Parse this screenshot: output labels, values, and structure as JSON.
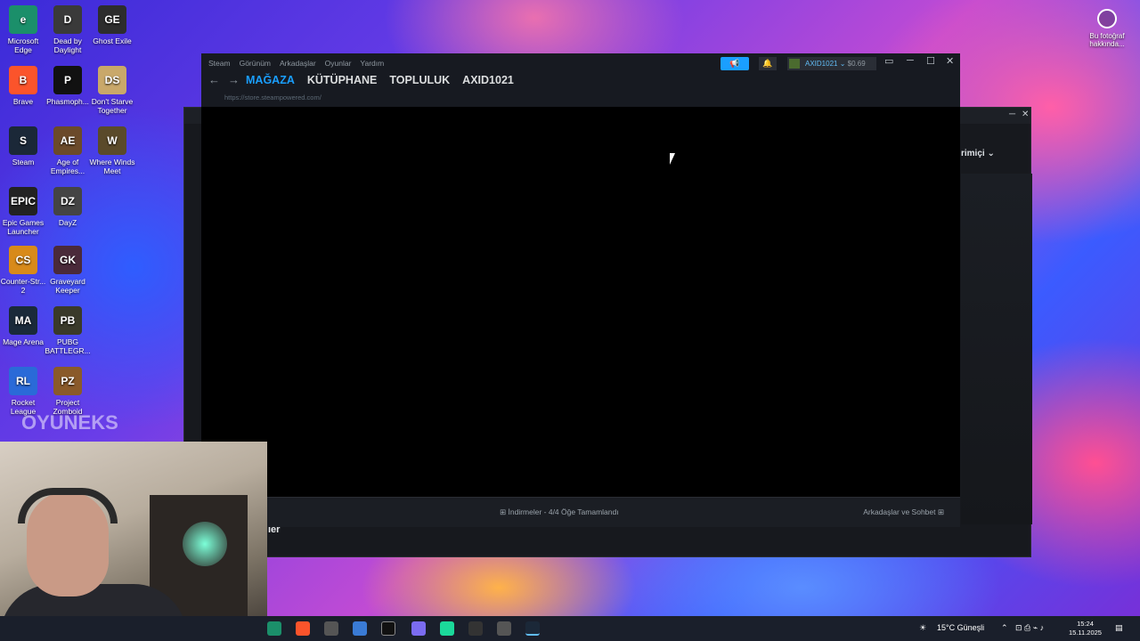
{
  "desktop": {
    "icons": [
      {
        "label": "Microsoft Edge",
        "color": "#1b8f6a",
        "glyph": "e"
      },
      {
        "label": "Dead by Daylight",
        "color": "#3a3a3a",
        "glyph": "D"
      },
      {
        "label": "Ghost Exile",
        "color": "#2d2d2d",
        "glyph": "GE"
      },
      {
        "label": "Brave",
        "color": "#fb542b",
        "glyph": "B"
      },
      {
        "label": "Phasmoph...",
        "color": "#111",
        "glyph": "P"
      },
      {
        "label": "Don't Starve Together",
        "color": "#c9a86a",
        "glyph": "DS"
      },
      {
        "label": "Steam",
        "color": "#1b2838",
        "glyph": "S"
      },
      {
        "label": "Age of Empires...",
        "color": "#6b4a2a",
        "glyph": "AE"
      },
      {
        "label": "Where Winds Meet",
        "color": "#5a4a2a",
        "glyph": "W"
      },
      {
        "label": "Epic Games Launcher",
        "color": "#222",
        "glyph": "EPIC"
      },
      {
        "label": "DayZ",
        "color": "#444",
        "glyph": "DZ"
      },
      {
        "label": "Counter-Str... 2",
        "color": "#d88a1a",
        "glyph": "CS"
      },
      {
        "label": "Graveyard Keeper",
        "color": "#4a2a3a",
        "glyph": "GK"
      },
      {
        "label": "Mage Arena",
        "color": "#1a2a3a",
        "glyph": "MA"
      },
      {
        "label": "PUBG BATTLEGR...",
        "color": "#3a3a2a",
        "glyph": "PB"
      },
      {
        "label": "Rocket League",
        "color": "#2a6ad8",
        "glyph": "RL"
      },
      {
        "label": "Project Zomboid",
        "color": "#8a5a2a",
        "glyph": "PZ"
      }
    ],
    "photo_info": "Bu fotoğraf hakkında..."
  },
  "steam": {
    "menu": [
      "Steam",
      "Görünüm",
      "Arkadaşlar",
      "Oyunlar",
      "Yardım"
    ],
    "nav": [
      {
        "label": "MAĞAZA",
        "active": true
      },
      {
        "label": "KÜTÜPHANE"
      },
      {
        "label": "TOPLULUK"
      },
      {
        "label": "AXID1021"
      }
    ],
    "url": "https://store.steampowered.com/",
    "account": {
      "name": "AXID1021",
      "balance": "$0.69"
    },
    "downloads": "İndirmeler - 4/4 Öğe Tamamlandı",
    "friends_chat": "Arkadaşlar ve Sohbet"
  },
  "friends_window": {
    "status": "rimiçi",
    "partial_name": "ler"
  },
  "webcam": {
    "watermark": "OYUNEKS"
  },
  "taskbar": {
    "weather": "15°C  Güneşli",
    "time": "15:24",
    "date": "15.11.2025"
  }
}
